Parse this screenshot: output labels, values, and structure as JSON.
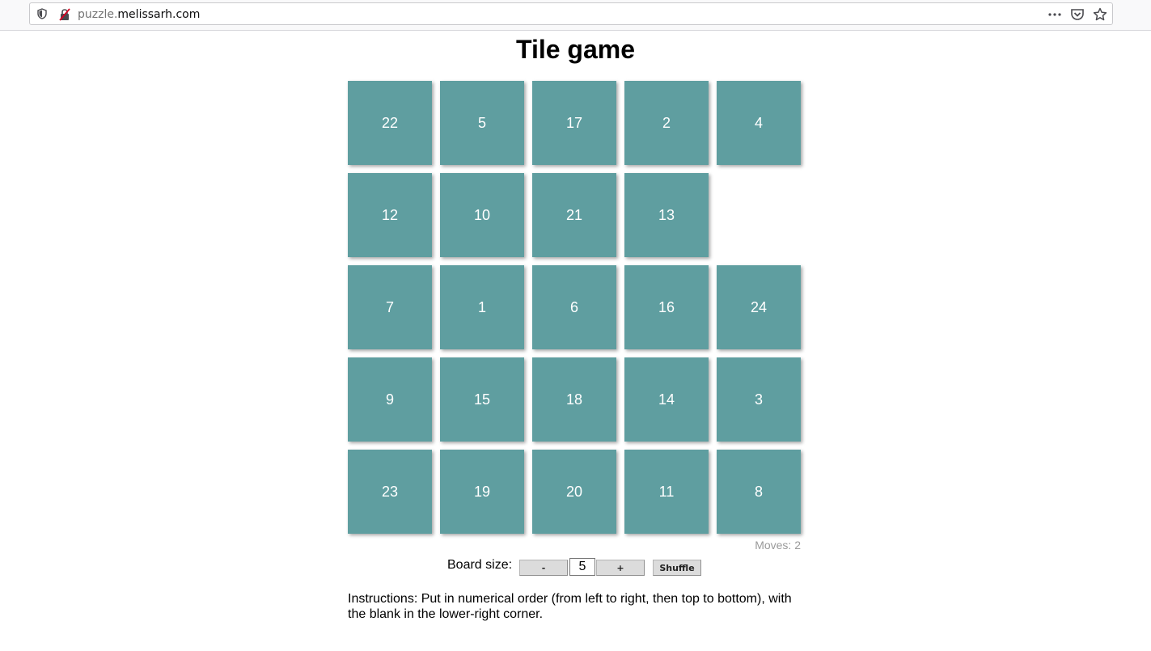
{
  "browser": {
    "url_prefix": "puzzle.",
    "url_domain": "melissarh.com",
    "icons": [
      "shield-icon",
      "insecure-lock-icon",
      "more-icon",
      "pocket-icon",
      "bookmark-star-icon"
    ]
  },
  "page": {
    "title": "Tile game"
  },
  "board": {
    "size": 5,
    "tile_color": "#5f9ea0",
    "tiles": [
      [
        "22",
        "5",
        "17",
        "2",
        "4"
      ],
      [
        "12",
        "10",
        "21",
        "13",
        ""
      ],
      [
        "7",
        "1",
        "6",
        "16",
        "24"
      ],
      [
        "9",
        "15",
        "18",
        "14",
        "3"
      ],
      [
        "23",
        "19",
        "20",
        "11",
        "8"
      ]
    ]
  },
  "status": {
    "moves_label": "Moves:",
    "moves_value": "2"
  },
  "controls": {
    "board_size_label": "Board size:",
    "minus_label": "-",
    "size_value": "5",
    "plus_label": "+",
    "shuffle_label": "Shuffle"
  },
  "instructions": "Instructions: Put in numerical order (from left to right, then top to bottom), with the blank in the lower-right corner."
}
